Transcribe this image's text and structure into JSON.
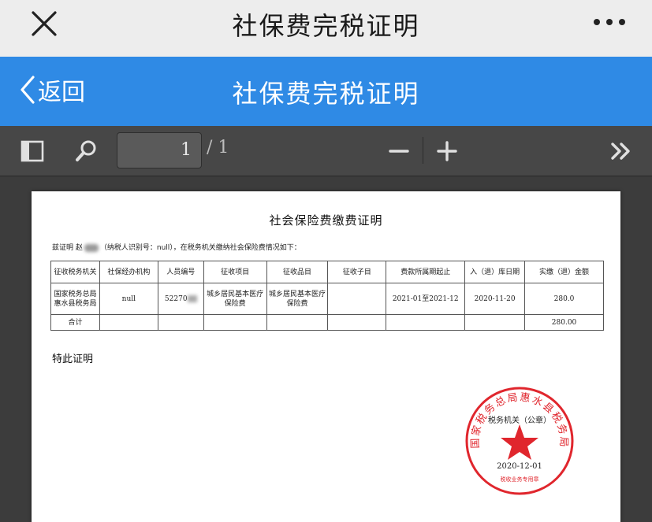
{
  "app": {
    "window_title": "社保费完税证明",
    "nav_title": "社保费完税证明",
    "back_label": "返回"
  },
  "viewer": {
    "current_page": "1",
    "total_pages": "/ 1"
  },
  "document": {
    "title": "社会保险费缴费证明",
    "intro_prefix": "兹证明 赵",
    "intro_suffix": "（纳税人识别号：null），在税务机关缴纳社会保险费情况如下：",
    "table": {
      "headers": [
        "征收税务机关",
        "社保经办机构",
        "人员编号",
        "征收项目",
        "征收品目",
        "征收子目",
        "费款所属期起止",
        "入（退）库日期",
        "实缴（退）金额"
      ],
      "row": {
        "authority": "国家税务总局惠水县税务局",
        "agency": "null",
        "person_id": "52270",
        "item": "城乡居民基本医疗保险费",
        "category": "城乡居民基本医疗保险费",
        "subitem": "",
        "period": "2021-01至2021-12",
        "date": "2020-11-20",
        "amount": "280.0"
      },
      "total_label": "合计",
      "total_amount": "280.00"
    },
    "certify": "特此证明",
    "stamp": {
      "ring_text": "国家税务总局惠水县税务局",
      "center_text": "税务机关（公章）",
      "date": "2020-12-01",
      "bottom_text": "税收业务专用章",
      "color": "#e0262d"
    }
  },
  "colors": {
    "nav_blue": "#2f8ae5",
    "toolbar_gray": "#474747",
    "top_bar": "#ededed"
  }
}
